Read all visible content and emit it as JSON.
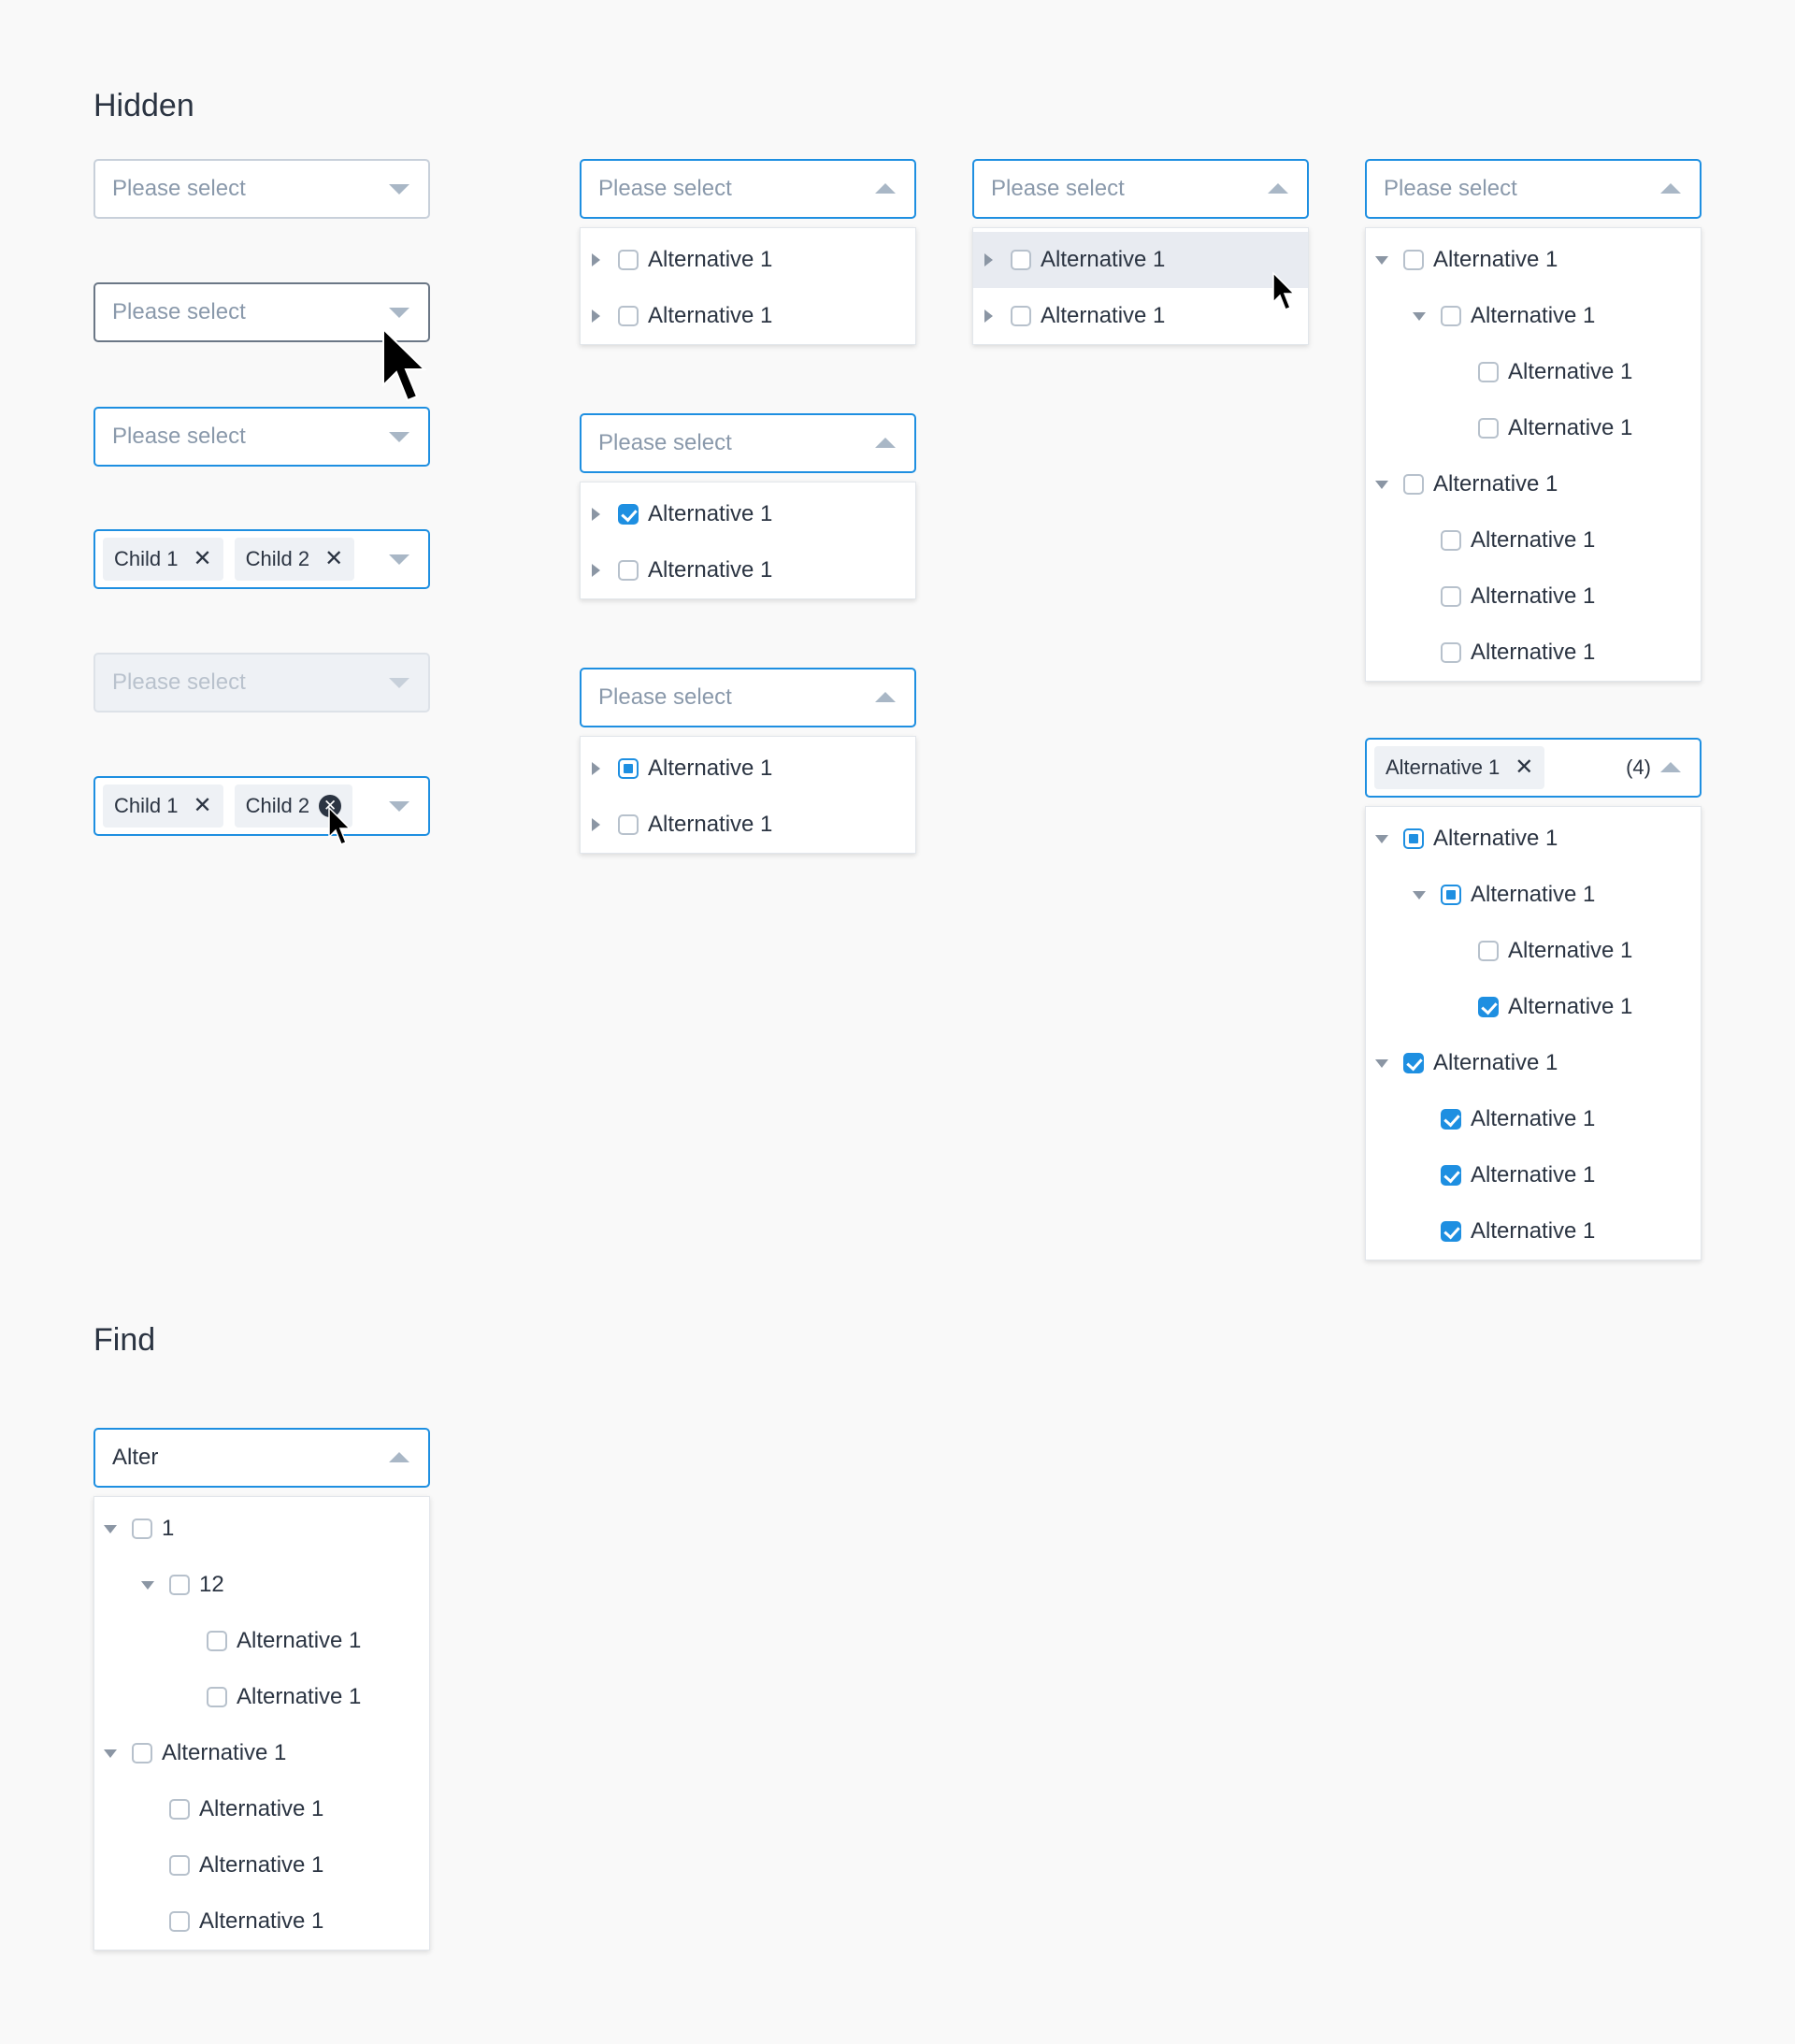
{
  "sections": {
    "hidden_title": "Hidden",
    "find_title": "Find"
  },
  "placeholder": "Please select",
  "option_label": "Alternative 1",
  "tags": {
    "child1": "Child 1",
    "child2": "Child 2",
    "selected_alt": "Alternative 1",
    "overflow_count": "(4)"
  },
  "find": {
    "query": "Alter",
    "node_1": "1",
    "node_12": "12"
  },
  "colors": {
    "accent": "#1e8fe1",
    "background": "#f9f9f9",
    "text": "#2b3442",
    "placeholder": "#8a99ab"
  }
}
